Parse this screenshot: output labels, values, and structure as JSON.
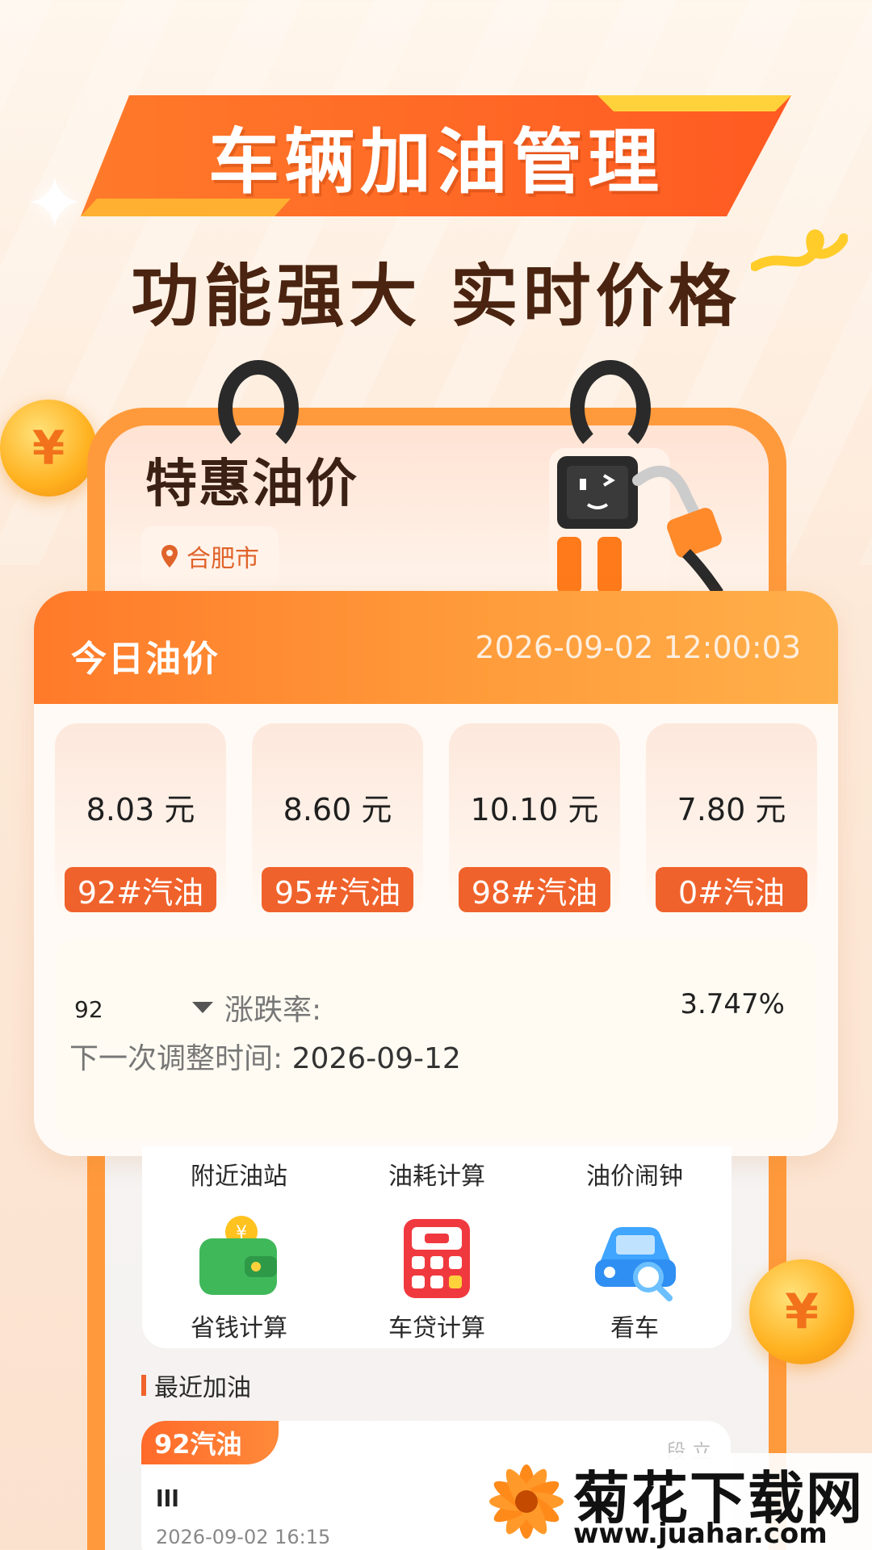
{
  "banner": {
    "title": "车辆加油管理"
  },
  "subtitle": "功能强大 实时价格",
  "coin_symbol": "¥",
  "special": {
    "title": "特惠油价",
    "city": "合肥市"
  },
  "today": {
    "title": "今日油价",
    "datetime": "2026-09-02 12:00:03",
    "prices": [
      {
        "value": "8.03 元",
        "label": "92#汽油"
      },
      {
        "value": "8.60 元",
        "label": "95#汽油"
      },
      {
        "value": "10.10 元",
        "label": "98#汽油"
      },
      {
        "value": "7.80 元",
        "label": "0#汽油"
      }
    ],
    "rate": {
      "grade": "92",
      "label": "涨跌率:",
      "value": "3.747%"
    },
    "next": {
      "label": "下一次调整时间:",
      "value": "2026-09-12"
    }
  },
  "tools": {
    "top": [
      "附近油站",
      "油耗计算",
      "油价闹钟"
    ],
    "bottom": [
      "省钱计算",
      "车贷计算",
      "看车"
    ]
  },
  "recent": {
    "title": "最近加油",
    "tag": "92汽油",
    "name": "lll",
    "date": "2026-09-02  16:15",
    "right": "段 立"
  },
  "watermark": {
    "name": "菊花下载网",
    "url": "www.juahar.com"
  },
  "colors": {
    "accent": "#f0622b",
    "frame": "#ff9a3c",
    "title_dark": "#4a2410"
  }
}
